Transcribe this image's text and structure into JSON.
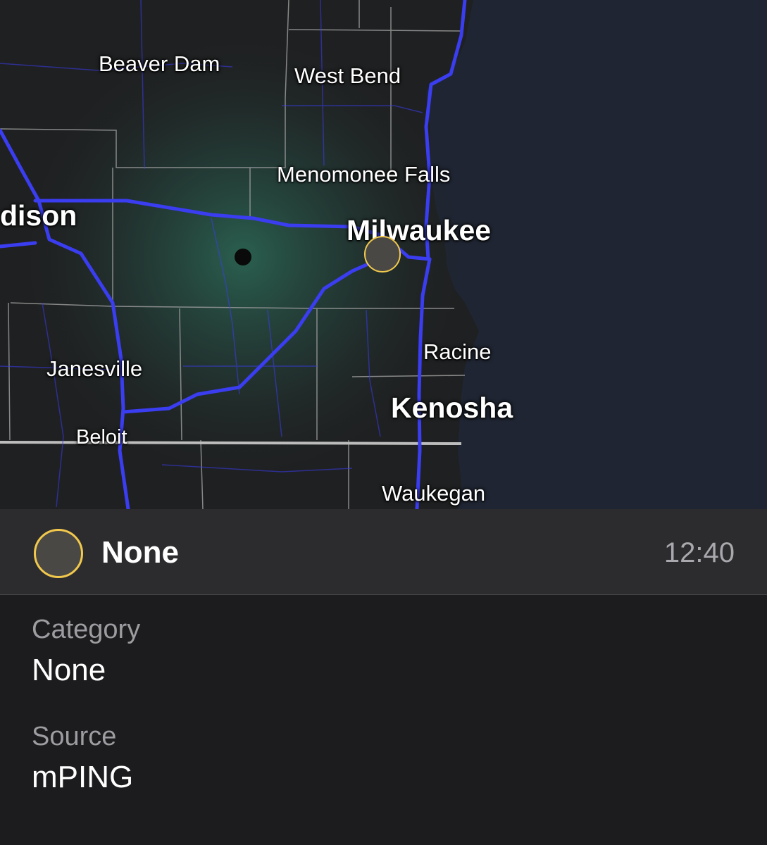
{
  "map": {
    "cities": [
      {
        "id": "madison",
        "label": "dison"
      },
      {
        "id": "beaver-dam",
        "label": "Beaver Dam"
      },
      {
        "id": "west-bend",
        "label": "West Bend"
      },
      {
        "id": "menomonee-falls",
        "label": "Menomonee Falls"
      },
      {
        "id": "milwaukee",
        "label": "Milwaukee"
      },
      {
        "id": "racine",
        "label": "Racine"
      },
      {
        "id": "kenosha",
        "label": "Kenosha"
      },
      {
        "id": "janesville",
        "label": "Janesville"
      },
      {
        "id": "beloit",
        "label": "Beloit"
      },
      {
        "id": "waukegan",
        "label": "Waukegan"
      }
    ],
    "colors": {
      "land": "#1f2021",
      "water": "#1f2532",
      "highway": "#3a3df0",
      "borders": "#9a9a9a",
      "radar": "#3fd7a4",
      "marker_fill": "#4a4845",
      "marker_ring": "#f2c94c"
    }
  },
  "report": {
    "title": "None",
    "time": "12:40",
    "icon": "report-circle-icon"
  },
  "details": {
    "category_label": "Category",
    "category_value": "None",
    "source_label": "Source",
    "source_value": "mPING"
  }
}
